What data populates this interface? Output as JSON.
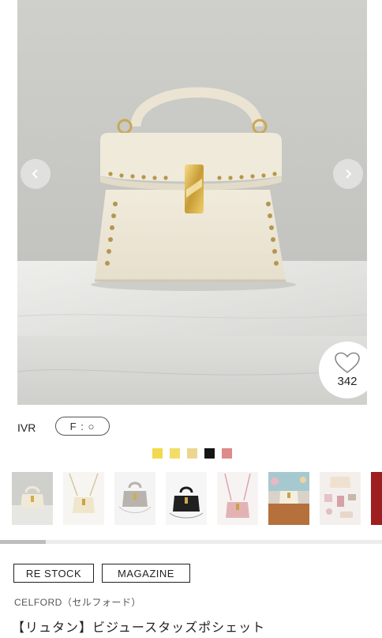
{
  "gallery": {
    "prev_icon": "chevron-left-icon",
    "next_icon": "chevron-right-icon",
    "like_icon": "heart-outline-icon",
    "like_count": "342"
  },
  "variant": {
    "color_code": "IVR",
    "size_label": "F : ○"
  },
  "color_swatches": [
    {
      "name": "yellow",
      "hex": "#f2d94e"
    },
    {
      "name": "light-yellow",
      "hex": "#f3dd6a"
    },
    {
      "name": "beige",
      "hex": "#ecd58f"
    },
    {
      "name": "black",
      "hex": "#151515"
    },
    {
      "name": "pink",
      "hex": "#dd8a8a"
    }
  ],
  "thumbnails": [
    {
      "name": "ivory-bag",
      "active": true
    },
    {
      "name": "cream-bag-strap"
    },
    {
      "name": "gray-bag"
    },
    {
      "name": "black-bag"
    },
    {
      "name": "pink-bag-strap"
    },
    {
      "name": "bag-on-table"
    },
    {
      "name": "bag-contents"
    },
    {
      "name": "red-bag"
    }
  ],
  "scroll_progress": 0.12,
  "tags": {
    "restock": "RE STOCK",
    "magazine": "MAGAZINE"
  },
  "product": {
    "brand": "CELFORD（セルフォード）",
    "title": "【リュタン】ビジュースタッズポシェット"
  }
}
